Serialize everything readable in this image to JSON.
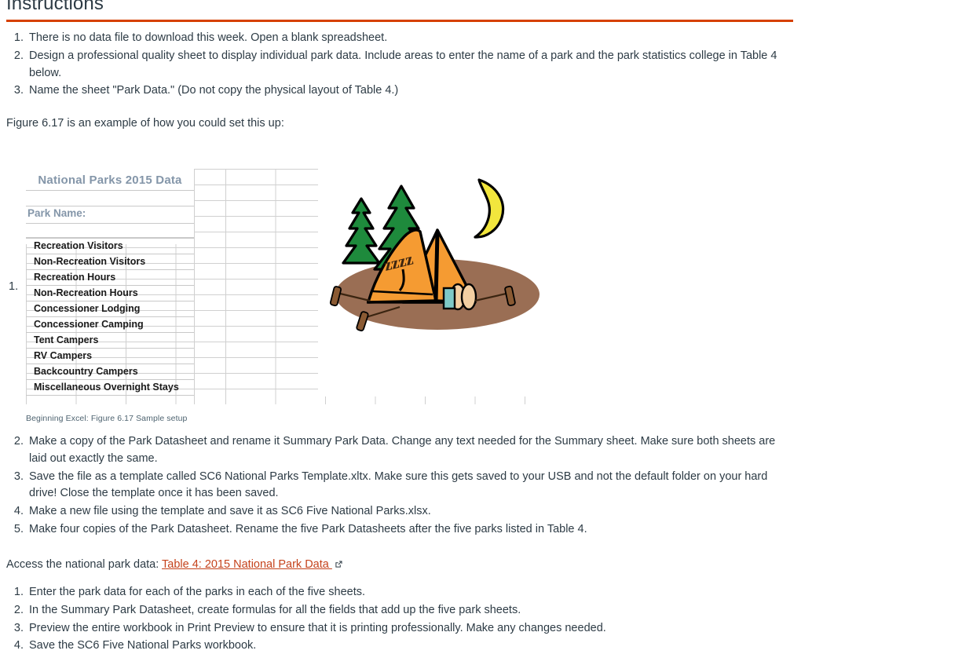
{
  "header": {
    "title": "Instructions",
    "rule_color": "#d64000"
  },
  "instructions_top": [
    {
      "num": "1.",
      "text": "There is no data file to download this week. Open a blank spreadsheet."
    },
    {
      "num": "2.",
      "text": "Design a professional quality sheet to display individual park data.  Include areas to enter the name of a park and the park statistics college in Table 4 below."
    },
    {
      "num": "3.",
      "text": "Name the sheet \"Park Data.\" (Do not copy the physical layout of Table 4.)"
    }
  ],
  "intro_line": "Figure 6.17 is an example of how you could set this up:",
  "figure": {
    "list_marker": "1.",
    "spreadsheet": {
      "title": "National Parks 2015 Data",
      "park_name_label": "Park Name:",
      "stat_labels": [
        "Recreation Visitors",
        "Non-Recreation Visitors",
        "Recreation Hours",
        "Non-Recreation Hours",
        "Concessioner Lodging",
        "Concessioner Camping",
        "Tent Campers",
        "RV Campers",
        "Backcountry Campers",
        "Miscellaneous Overnight Stays"
      ],
      "title_color": "#8496a9",
      "label_color": "#1a1a1a",
      "gridline_color": "#d0d0d0"
    },
    "clipart": {
      "name": "camping-tent-night-clipart",
      "zzz_text": "zzzz",
      "tent_color": "#F59B32",
      "tree_color": "#1E8A3C",
      "moon_color": "#F2E63D",
      "ground_color": "#9A6E54"
    },
    "caption": "Beginning Excel: Figure 6.17 Sample setup"
  },
  "instructions_mid": [
    {
      "num": "2.",
      "text": "Make a copy of the Park Datasheet and rename it Summary Park Data. Change any text needed for the Summary sheet. Make sure both sheets are laid out exactly the same."
    },
    {
      "num": "3.",
      "text": "Save the file as a template called SC6 National Parks Template.xltx. Make sure this gets saved to your USB and not the default folder on your hard drive! Close the template once it has been saved."
    },
    {
      "num": "4.",
      "text": "Make a new file using the template and save it as SC6 Five National Parks.xlsx."
    },
    {
      "num": "5.",
      "text": "Make four copies of the Park Datasheet. Rename the five Park Datasheets after the five parks listed in Table 4."
    }
  ],
  "access": {
    "prefix": "Access the national park data: ",
    "link_text": "Table 4: 2015 National Park Data ",
    "link_color": "#c5431c",
    "icon": "external-link-icon"
  },
  "instructions_bottom": [
    {
      "num": "1.",
      "text": "Enter the park data for each of the parks in each of the five sheets."
    },
    {
      "num": "2.",
      "text": "In the Summary Park Datasheet, create formulas for all the fields that add up the five park sheets."
    },
    {
      "num": "3.",
      "text": "Preview the entire workbook in Print Preview to ensure that it is printing professionally.  Make any changes needed."
    },
    {
      "num": "4.",
      "text": "Save the SC6 Five National Parks workbook."
    }
  ]
}
